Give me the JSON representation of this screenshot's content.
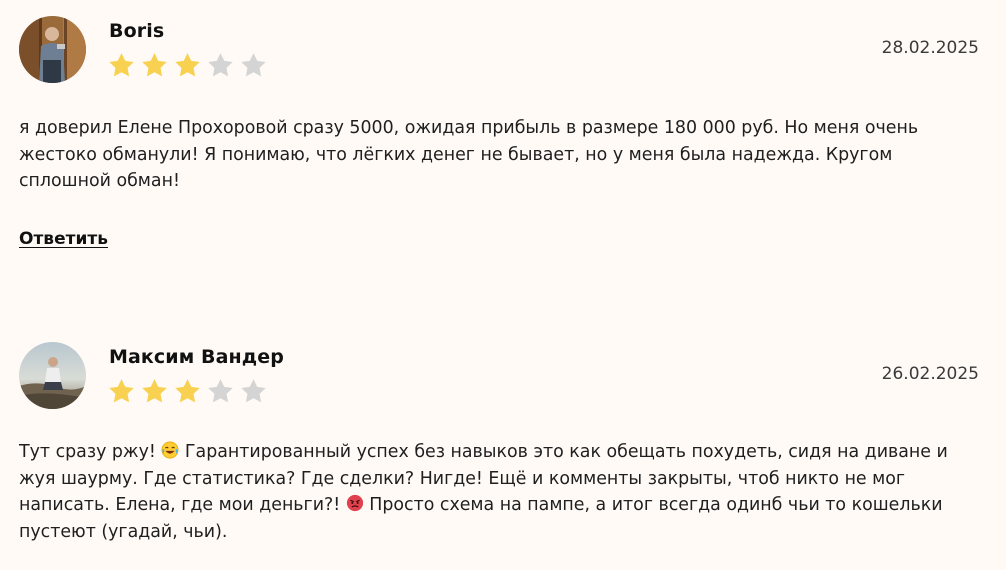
{
  "reviews": [
    {
      "author": "Boris",
      "date": "28.02.2025",
      "rating": 3,
      "max_rating": 5,
      "text": "я доверил Елене Прохоровой сразу 5000, ожидая прибыль в размере 180 000 руб. Но меня очень жестоко обманули! Я понимаю, что лёгких денег не бывает, но у меня была надежда. Кругом сплошной обман!",
      "reply_label": "Ответить"
    },
    {
      "author": "Максим Вандер",
      "date": "26.02.2025",
      "rating": 3,
      "max_rating": 5,
      "text_part_1": "Тут сразу ржу! ",
      "emoji_1": "laughing-crying-emoji",
      "text_part_2": " Гарантированный успех без навыков это как обещать похудеть, сидя на диване и жуя шаурму. Где статистика? Где сделки? Нигде! Ещё и комменты закрыты, чтоб никто не мог написать. Елена, где мои деньги?! ",
      "emoji_2": "angry-face-emoji",
      "text_part_3": " Просто схема на пампе, а итог всегда одинб чьи то кошельки пустеют (угадай, чьи)."
    }
  ],
  "colors": {
    "background": "#fffaf6",
    "star_filled": "#f7d14f",
    "star_empty": "#d4d4d4",
    "text": "#1f1f1f"
  }
}
